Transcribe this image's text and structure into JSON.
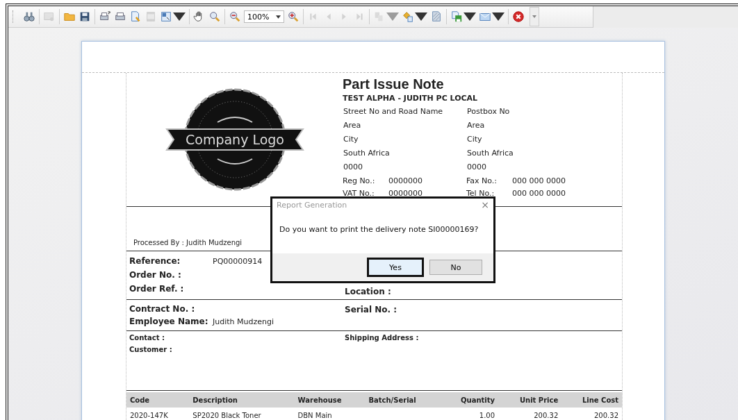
{
  "toolbar": {
    "groups": [
      [
        {
          "disabled": false,
          "dropdown": false
        }
      ],
      [
        {
          "disabled": true,
          "dropdown": false
        }
      ],
      [
        {
          "disabled": false,
          "dropdown": false
        },
        {
          "disabled": false,
          "dropdown": false
        }
      ],
      [
        {
          "disabled": false,
          "dropdown": false
        },
        {
          "disabled": false,
          "dropdown": false
        },
        {
          "disabled": false,
          "dropdown": false
        },
        {
          "disabled": true,
          "dropdown": false
        },
        {
          "disabled": false,
          "dropdown": true
        }
      ],
      [
        {
          "disabled": false,
          "dropdown": false
        },
        {
          "disabled": false,
          "dropdown": false
        }
      ],
      [
        {
          "disabled": false,
          "dropdown": false
        },
        {
          "kind": "zoom",
          "value": "100%"
        },
        {
          "disabled": false,
          "dropdown": false
        }
      ],
      [
        {
          "disabled": true,
          "dropdown": false
        },
        {
          "disabled": true,
          "dropdown": false
        },
        {
          "disabled": true,
          "dropdown": false
        },
        {
          "disabled": true,
          "dropdown": false
        }
      ],
      [
        {
          "disabled": true,
          "dropdown": true
        },
        {
          "disabled": false,
          "dropdown": true
        },
        {
          "disabled": false,
          "dropdown": false
        }
      ],
      [
        {
          "disabled": false,
          "dropdown": true
        },
        {
          "disabled": false,
          "dropdown": true
        }
      ],
      [
        {
          "disabled": false,
          "dropdown": false
        }
      ]
    ]
  },
  "report": {
    "logo_text": "Company Logo",
    "title": "Part Issue Note",
    "company": "TEST ALPHA - JUDITH PC LOCAL",
    "address_columns": [
      {
        "lines": [
          "Street No and Road Name",
          "Area",
          "City",
          "South Africa",
          "0000"
        ],
        "fields": [
          {
            "label": "Reg No.:",
            "value": "0000000"
          },
          {
            "label": "VAT No.:",
            "value": "0000000"
          }
        ]
      },
      {
        "lines": [
          "Postbox No",
          "Area",
          "City",
          "South Africa",
          "0000"
        ],
        "fields": [
          {
            "label": "Fax No.:",
            "value": "000 000 0000"
          },
          {
            "label": "Tel No.:",
            "value": "000 000 0000"
          }
        ]
      }
    ],
    "processed_by": "Processed By : Judith Mudzengi",
    "reference_block": {
      "left": [
        {
          "label": "Reference:",
          "value": "PQ00000914"
        },
        {
          "label": "Order No. :"
        },
        {
          "label": "Order Ref. :"
        }
      ],
      "right_label": "Location :"
    },
    "contract_block": {
      "contract_label": "Contract No. :",
      "serial_label": "Serial No. :",
      "employee_label": "Employee Name:",
      "employee_value": "Judith Mudzengi"
    },
    "contact_block": {
      "contact_label": "Contact :",
      "customer_label": "Customer :",
      "shipping_label": "Shipping Address :"
    },
    "table": {
      "columns": [
        "Code",
        "Description",
        "Warehouse",
        "Batch/Serial",
        "Quantity",
        "Unit Price",
        "Line Cost"
      ],
      "rows": [
        [
          "2020-147K",
          "SP2020 Black Toner",
          "DBN Main",
          "",
          "1.00",
          "200.32",
          "200.32"
        ]
      ]
    }
  },
  "dialog": {
    "title": "Report Generation",
    "close": "×",
    "message": "Do you want to print the delivery note SI00000169?",
    "buttons": [
      {
        "label": "Yes",
        "selected": true
      },
      {
        "label": "No",
        "selected": false
      }
    ]
  }
}
